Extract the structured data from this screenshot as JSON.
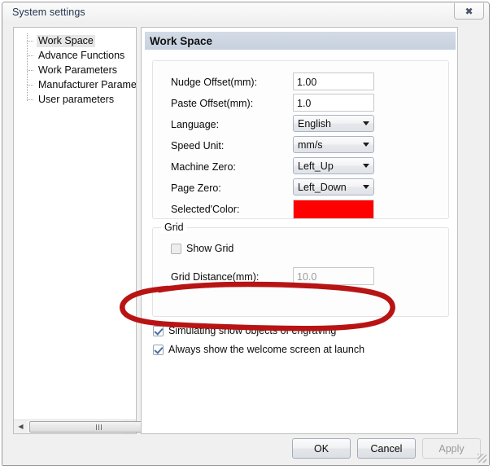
{
  "window": {
    "title": "System settings",
    "close_label": "✕"
  },
  "sidebar": {
    "items": [
      {
        "label": "Work Space",
        "selected": true
      },
      {
        "label": "Advance Functions",
        "selected": false
      },
      {
        "label": "Work Parameters",
        "selected": false
      },
      {
        "label": "Manufacturer Paramet",
        "selected": false
      },
      {
        "label": "User parameters",
        "selected": false
      }
    ],
    "scrollbar": {
      "left_arrow": "◀",
      "right_arrow": "▶"
    }
  },
  "main": {
    "section_title": "Work Space",
    "fields": [
      {
        "label": "Nudge Offset(mm):",
        "type": "text",
        "value": "1.00"
      },
      {
        "label": "Paste Offset(mm):",
        "type": "text",
        "value": "1.0"
      },
      {
        "label": "Language:",
        "type": "combo",
        "value": "English"
      },
      {
        "label": "Speed Unit:",
        "type": "combo",
        "value": "mm/s"
      },
      {
        "label": "Machine Zero:",
        "type": "combo",
        "value": "Left_Up"
      },
      {
        "label": "Page Zero:",
        "type": "combo",
        "value": "Left_Down"
      },
      {
        "label": "Selected'Color:",
        "type": "color",
        "value": "#FF0000"
      }
    ],
    "grid_group": {
      "legend": "Grid",
      "show_grid": {
        "label": "Show Grid",
        "checked": false
      },
      "distance": {
        "label": "Grid Distance(mm):",
        "value": "10.0",
        "disabled": true
      }
    },
    "options": [
      {
        "label": "Simulating show objects of engraving",
        "checked": true
      },
      {
        "label": "Always show the welcome screen at launch",
        "checked": true
      }
    ]
  },
  "footer": {
    "ok": "OK",
    "cancel": "Cancel",
    "apply": "Apply"
  },
  "annotation": {
    "color": "#b81414",
    "shape": "hand-drawn-ellipse"
  }
}
